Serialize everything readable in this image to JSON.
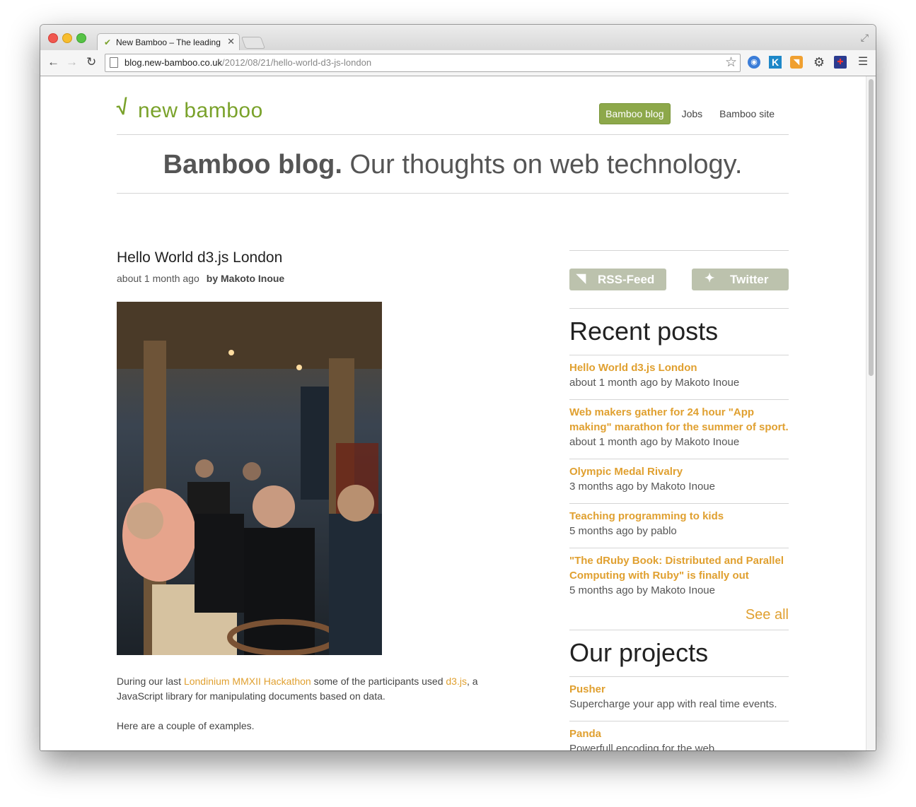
{
  "browser": {
    "tab_title": "New Bamboo – The leading R",
    "url_host": "blog.new-bamboo.co.uk",
    "url_path": "/2012/08/21/hello-world-d3-js-london"
  },
  "site": {
    "logo_text": "new bamboo",
    "nav": [
      "Bamboo blog",
      "Jobs",
      "Bamboo site"
    ],
    "tagline_bold": "Bamboo blog.",
    "tagline_rest": " Our thoughts on web technology."
  },
  "post": {
    "title": "Hello World d3.js London",
    "date": "about 1 month ago",
    "author": "by Makoto Inoue",
    "p1_a": "During our last ",
    "p1_link1": "Londinium MMXII Hackathon",
    "p1_b": " some of the participants used ",
    "p1_link2": "d3.js",
    "p1_c": ", a",
    "p1_line2": "JavaScript library for manipulating documents based on data.",
    "p2": "Here are a couple of examples."
  },
  "sidebar": {
    "rss_label": "RSS-Feed",
    "twitter_label": "Twitter",
    "recent_heading": "Recent posts",
    "recent": [
      {
        "title": "Hello World d3.js London",
        "meta": "about 1 month ago by Makoto Inoue"
      },
      {
        "title": "Web makers gather for 24 hour \"App making\" marathon for the summer of sport.",
        "meta": "about 1 month ago by Makoto Inoue"
      },
      {
        "title": "Olympic Medal Rivalry",
        "meta": "3 months ago by Makoto Inoue"
      },
      {
        "title": "Teaching programming to kids",
        "meta": "5 months ago by pablo"
      },
      {
        "title": "\"The dRuby Book: Distributed and Parallel Computing with Ruby\" is finally out",
        "meta": "5 months ago by Makoto Inoue"
      }
    ],
    "see_all": "See all",
    "projects_heading": "Our projects",
    "projects": [
      {
        "title": "Pusher",
        "meta": "Supercharge your app with real time events."
      },
      {
        "title": "Panda",
        "meta": "Powerfull encoding for the web"
      }
    ]
  },
  "colors": {
    "accent": "#e0a030",
    "brand_green": "#7aa22b",
    "nav_active": "#8da84a"
  }
}
